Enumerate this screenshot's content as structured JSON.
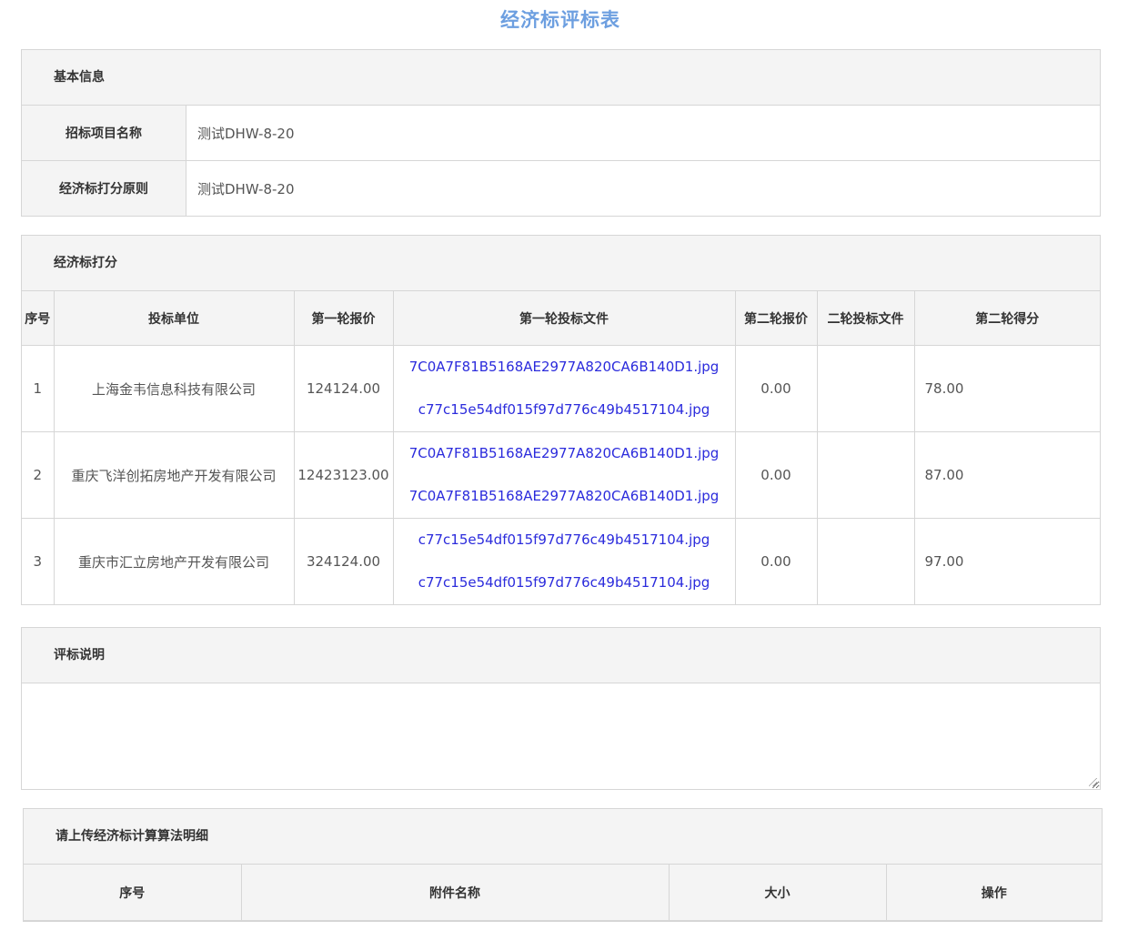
{
  "page": {
    "title": "经济标评标表"
  },
  "basic_info": {
    "header": "基本信息",
    "rows": [
      {
        "label": "招标项目名称",
        "value": "测试DHW-8-20"
      },
      {
        "label": "经济标打分原则",
        "value": "测试DHW-8-20"
      }
    ]
  },
  "scoring": {
    "header": "经济标打分",
    "columns": [
      "序号",
      "投标单位",
      "第一轮报价",
      "第一轮投标文件",
      "第二轮报价",
      "二轮投标文件",
      "第二轮得分"
    ],
    "rows": [
      {
        "index": "1",
        "company": "上海金韦信息科技有限公司",
        "price1": "124124.00",
        "files": [
          "7C0A7F81B5168AE2977A820CA6B140D1.jpg",
          "c77c15e54df015f97d776c49b4517104.jpg"
        ],
        "price2": "0.00",
        "files2": "",
        "score": "78.00"
      },
      {
        "index": "2",
        "company": "重庆飞洋创拓房地产开发有限公司",
        "price1": "12423123.00",
        "files": [
          "7C0A7F81B5168AE2977A820CA6B140D1.jpg",
          "7C0A7F81B5168AE2977A820CA6B140D1.jpg"
        ],
        "price2": "0.00",
        "files2": "",
        "score": "87.00"
      },
      {
        "index": "3",
        "company": "重庆市汇立房地产开发有限公司",
        "price1": "324124.00",
        "files": [
          "c77c15e54df015f97d776c49b4517104.jpg",
          "c77c15e54df015f97d776c49b4517104.jpg"
        ],
        "price2": "0.00",
        "files2": "",
        "score": "97.00"
      }
    ]
  },
  "notes": {
    "header": "评标说明",
    "value": ""
  },
  "attachments": {
    "header": "请上传经济标计算算法明细",
    "columns": [
      "序号",
      "附件名称",
      "大小",
      "操作"
    ]
  },
  "colors": {
    "title": "#6d9fe0",
    "link": "#2b2bdc",
    "header_bg": "#f4f4f4",
    "border": "#d6d6d6"
  }
}
